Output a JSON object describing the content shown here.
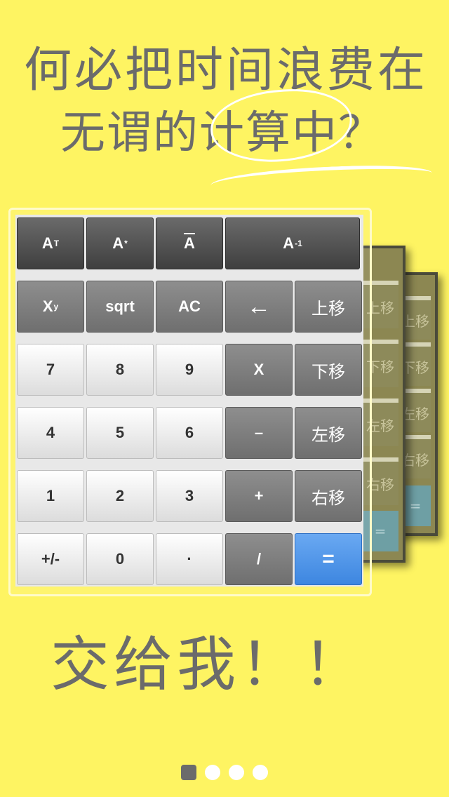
{
  "headline": {
    "line1": "何必把时间浪费在",
    "line2_prefix": "无谓的",
    "line2_highlight": "计算",
    "line2_suffix": "中？"
  },
  "bottom_text": "交给我！！",
  "calculator": {
    "row1": {
      "transpose": "A",
      "transpose_sup": "T",
      "conjugate": "A",
      "conjugate_sup": "*",
      "bar": "A",
      "inverse": "A",
      "inverse_sup": "-1"
    },
    "row2": {
      "power": "X",
      "power_sup": "y",
      "sqrt": "sqrt",
      "clear": "AC",
      "backspace": "←",
      "up": "上移"
    },
    "row3": {
      "seven": "7",
      "eight": "8",
      "nine": "9",
      "multiply": "X",
      "down": "下移"
    },
    "row4": {
      "four": "4",
      "five": "5",
      "six": "6",
      "minus": "–",
      "left": "左移"
    },
    "row5": {
      "one": "1",
      "two": "2",
      "three": "3",
      "plus": "+",
      "right": "右移"
    },
    "row6": {
      "negate": "+/-",
      "zero": "0",
      "dot": "·",
      "divide": "/",
      "equals": "="
    }
  },
  "back_cards": {
    "labels": [
      "上移",
      "下移",
      "左移",
      "右移",
      "="
    ]
  },
  "pager": {
    "count": 4,
    "active": 0
  },
  "colors": {
    "background": "#fef462",
    "text": "#6b6b6b",
    "equals": "#4a90e2"
  }
}
